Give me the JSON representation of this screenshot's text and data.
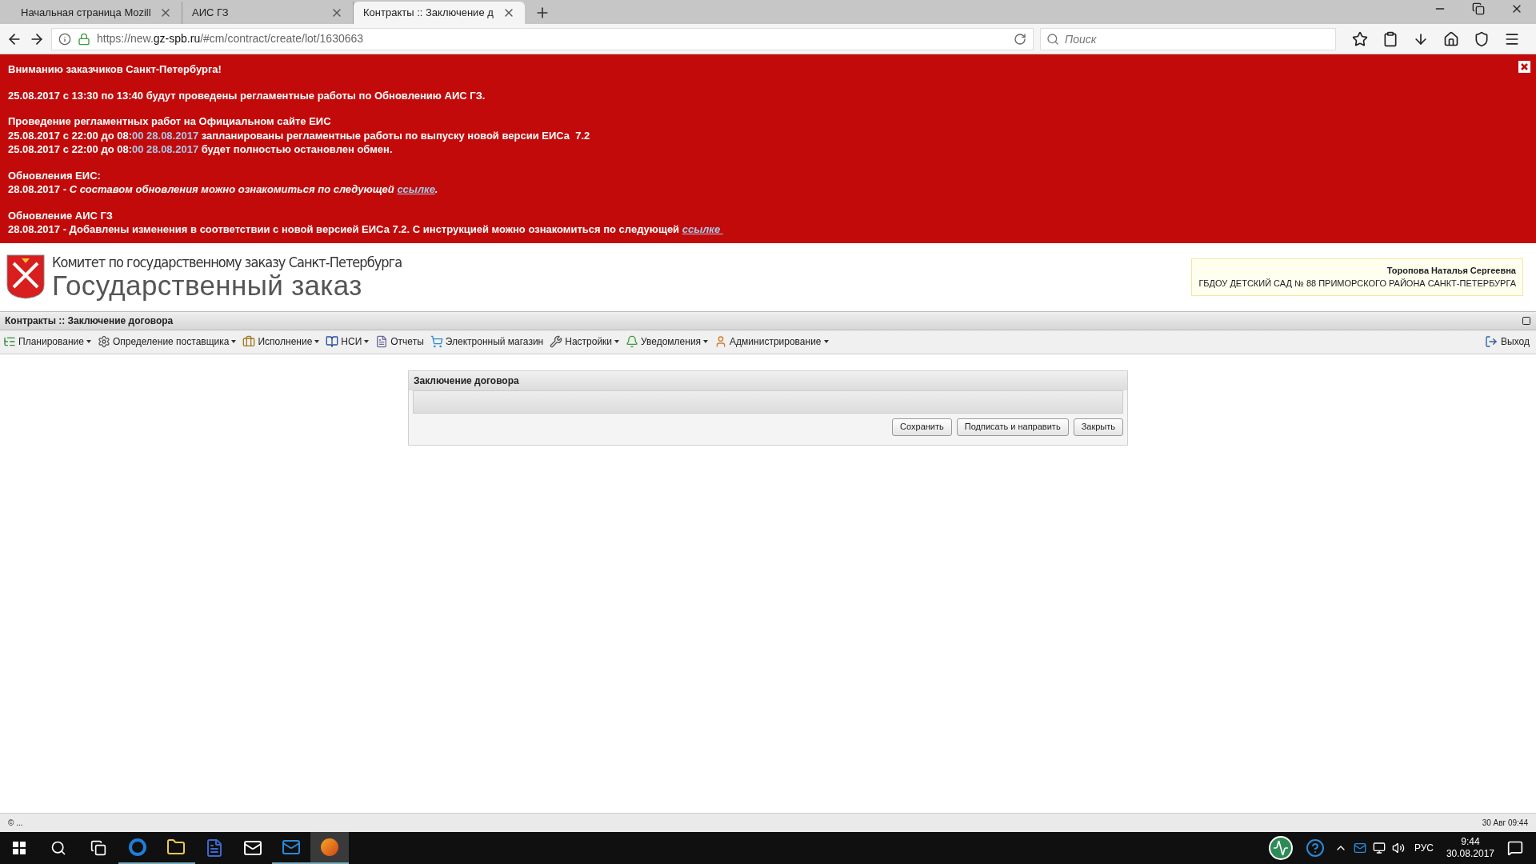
{
  "browser": {
    "tabs": [
      {
        "label": "Начальная страница Mozill",
        "selected": false
      },
      {
        "label": "АИС ГЗ",
        "selected": false
      },
      {
        "label": "Контракты :: Заключение д",
        "selected": true
      }
    ],
    "url_host": "https://new.",
    "url_domain": "gz-spb.ru",
    "url_path": "/#cm/contract/create/lot/1630663",
    "search": {
      "placeholder": "Поиск"
    }
  },
  "banner": {
    "paragraphs": [
      [
        [
          {
            "kind": "plain",
            "text": "Вниманию заказчиков Санкт-Петербурга!"
          }
        ]
      ],
      [
        [
          {
            "kind": "plain",
            "text": "25.08.2017 с 13:30 по 13:40 будут проведены регламентные работы по Обновлению АИС ГЗ."
          }
        ]
      ],
      [
        [
          {
            "kind": "plain",
            "text": "Проведение регламентных работ на Официальном сайте ЕИС"
          }
        ],
        [
          {
            "kind": "plain",
            "text": "25.08.2017 с 22:00 до 08:"
          },
          {
            "kind": "date",
            "text": "00 28.08.2017"
          },
          {
            "kind": "plain",
            "text": " запланированы регламентные работы по выпуску новой версии ЕИСа  7.2"
          }
        ],
        [
          {
            "kind": "plain",
            "text": "25.08.2017 с 22:00 до 08:"
          },
          {
            "kind": "date",
            "text": "00 28.08.2017"
          },
          {
            "kind": "plain",
            "text": " будет полностью остановлен обмен."
          }
        ]
      ],
      [
        [
          {
            "kind": "plain",
            "text": "Обновления ЕИС:"
          }
        ],
        [
          {
            "kind": "plain",
            "text": "28.08.2017 - "
          },
          {
            "kind": "italic",
            "text": "С составом обновления можно ознакомиться по следующей "
          },
          {
            "kind": "link",
            "text": "ссылке"
          },
          {
            "kind": "italic",
            "text": "."
          }
        ]
      ],
      [
        [
          {
            "kind": "plain",
            "text": "Обновление АИС ГЗ"
          }
        ],
        [
          {
            "kind": "plain",
            "text": "28.08.2017 - Добавлены изменения в соответствии с новой версией ЕИСа 7.2. С инструкцией можно ознакомиться по следующей "
          },
          {
            "kind": "link",
            "text": "ссылке "
          }
        ]
      ]
    ]
  },
  "header": {
    "subtitle": "Комитет по государственному заказу Санкт-Петербурга",
    "title": "Государственный заказ",
    "user_name": "Торопова Наталья Сергеевна",
    "organization": "ГБДОУ ДЕТСКИЙ САД № 88 ПРИМОРСКОГО РАЙОНА САНКТ-ПЕТЕРБУРГА"
  },
  "page_title": "Контракты :: Заключение договора",
  "menu": [
    {
      "label": "Планирование",
      "dropdown": true
    },
    {
      "label": "Определение поставщика",
      "dropdown": true
    },
    {
      "label": "Исполнение",
      "dropdown": true
    },
    {
      "label": "НСИ",
      "dropdown": true
    },
    {
      "label": "Отчеты",
      "dropdown": false
    },
    {
      "label": "Электронный магазин",
      "dropdown": false
    },
    {
      "label": "Настройки",
      "dropdown": true
    },
    {
      "label": "Уведомления",
      "dropdown": true
    },
    {
      "label": "Администрирование",
      "dropdown": true
    }
  ],
  "logout": "Выход",
  "dialog": {
    "title": "Заключение договора",
    "buttons": [
      "Сохранить",
      "Подписать и направить",
      "Закрыть"
    ]
  },
  "status_bar": {
    "left": "© ...",
    "right": "30 Авг 09:44"
  },
  "taskbar": {
    "language": "РУС",
    "time": "9:44",
    "date": "30.08.2017"
  }
}
